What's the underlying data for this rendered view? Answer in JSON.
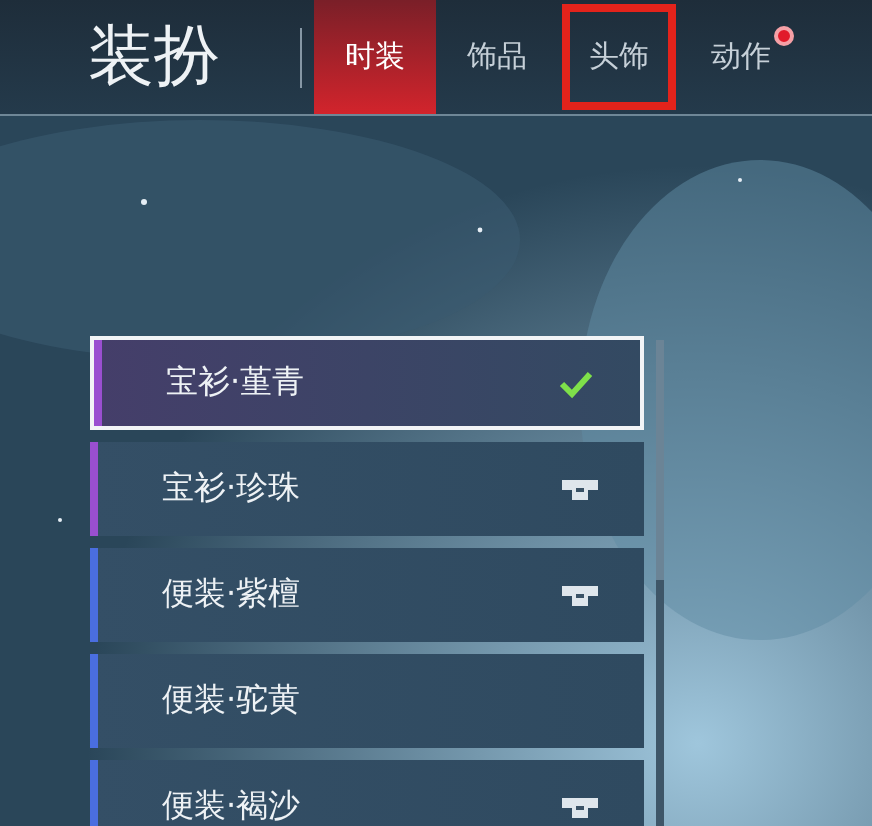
{
  "header": {
    "title": "装扮"
  },
  "tabs": [
    {
      "label": "时装",
      "selected": true,
      "highlighted": false,
      "badge": false
    },
    {
      "label": "饰品",
      "selected": false,
      "highlighted": false,
      "badge": false
    },
    {
      "label": "头饰",
      "selected": false,
      "highlighted": true,
      "badge": false
    },
    {
      "label": "动作",
      "selected": false,
      "highlighted": false,
      "badge": true
    }
  ],
  "items": [
    {
      "name": "宝衫·堇青",
      "color": "#9a4fd0",
      "selected": true,
      "kind": "equipped"
    },
    {
      "name": "宝衫·珍珠",
      "color": "#9a4fd0",
      "selected": false,
      "kind": "owned"
    },
    {
      "name": "便装·紫檀",
      "color": "#4a6ee0",
      "selected": false,
      "kind": "owned"
    },
    {
      "name": "便装·驼黄",
      "color": "#4a6ee0",
      "selected": false,
      "kind": "plain"
    },
    {
      "name": "便装·褐沙",
      "color": "#4a6ee0",
      "selected": false,
      "kind": "owned"
    }
  ]
}
